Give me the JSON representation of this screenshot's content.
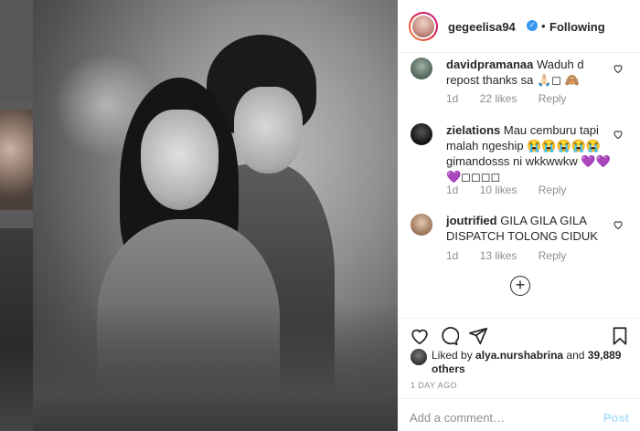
{
  "header": {
    "username": "gegeelisa94",
    "separator": "•",
    "follow_label": "Following"
  },
  "comments": [
    {
      "username": "davidpramanaa",
      "text": "Waduh d repost thanks sa 🙏🏻◻ 🙈",
      "time": "1d",
      "likes": "22 likes",
      "reply": "Reply"
    },
    {
      "username": "zielations",
      "text": "Mau cemburu tapi malah ngeship 😭😭😭😭😭 gimandosss ni wkkwwkw 💜💜 💜◻◻◻◻",
      "time": "1d",
      "likes": "10 likes",
      "reply": "Reply"
    },
    {
      "username": "joutrified",
      "text": "GILA GILA GILA DISPATCH TOLONG CIDUK",
      "time": "1d",
      "likes": "13 likes",
      "reply": "Reply"
    }
  ],
  "load_more_symbol": "+",
  "likes": {
    "prefix": "Liked by ",
    "user": "alya.nurshabrina",
    "middle": " and ",
    "count": "39,889 others"
  },
  "time_ago": "1 DAY AGO",
  "add_comment": {
    "placeholder": "Add a comment…",
    "post_label": "Post"
  },
  "icons": [
    "heart-icon",
    "comment-icon",
    "share-icon",
    "bookmark-icon",
    "verified-badge-icon",
    "add-circle-icon"
  ],
  "colors": {
    "link_blue": "#3897f0",
    "post_disabled": "#b2dffc",
    "muted_text": "#8e8e8e"
  }
}
